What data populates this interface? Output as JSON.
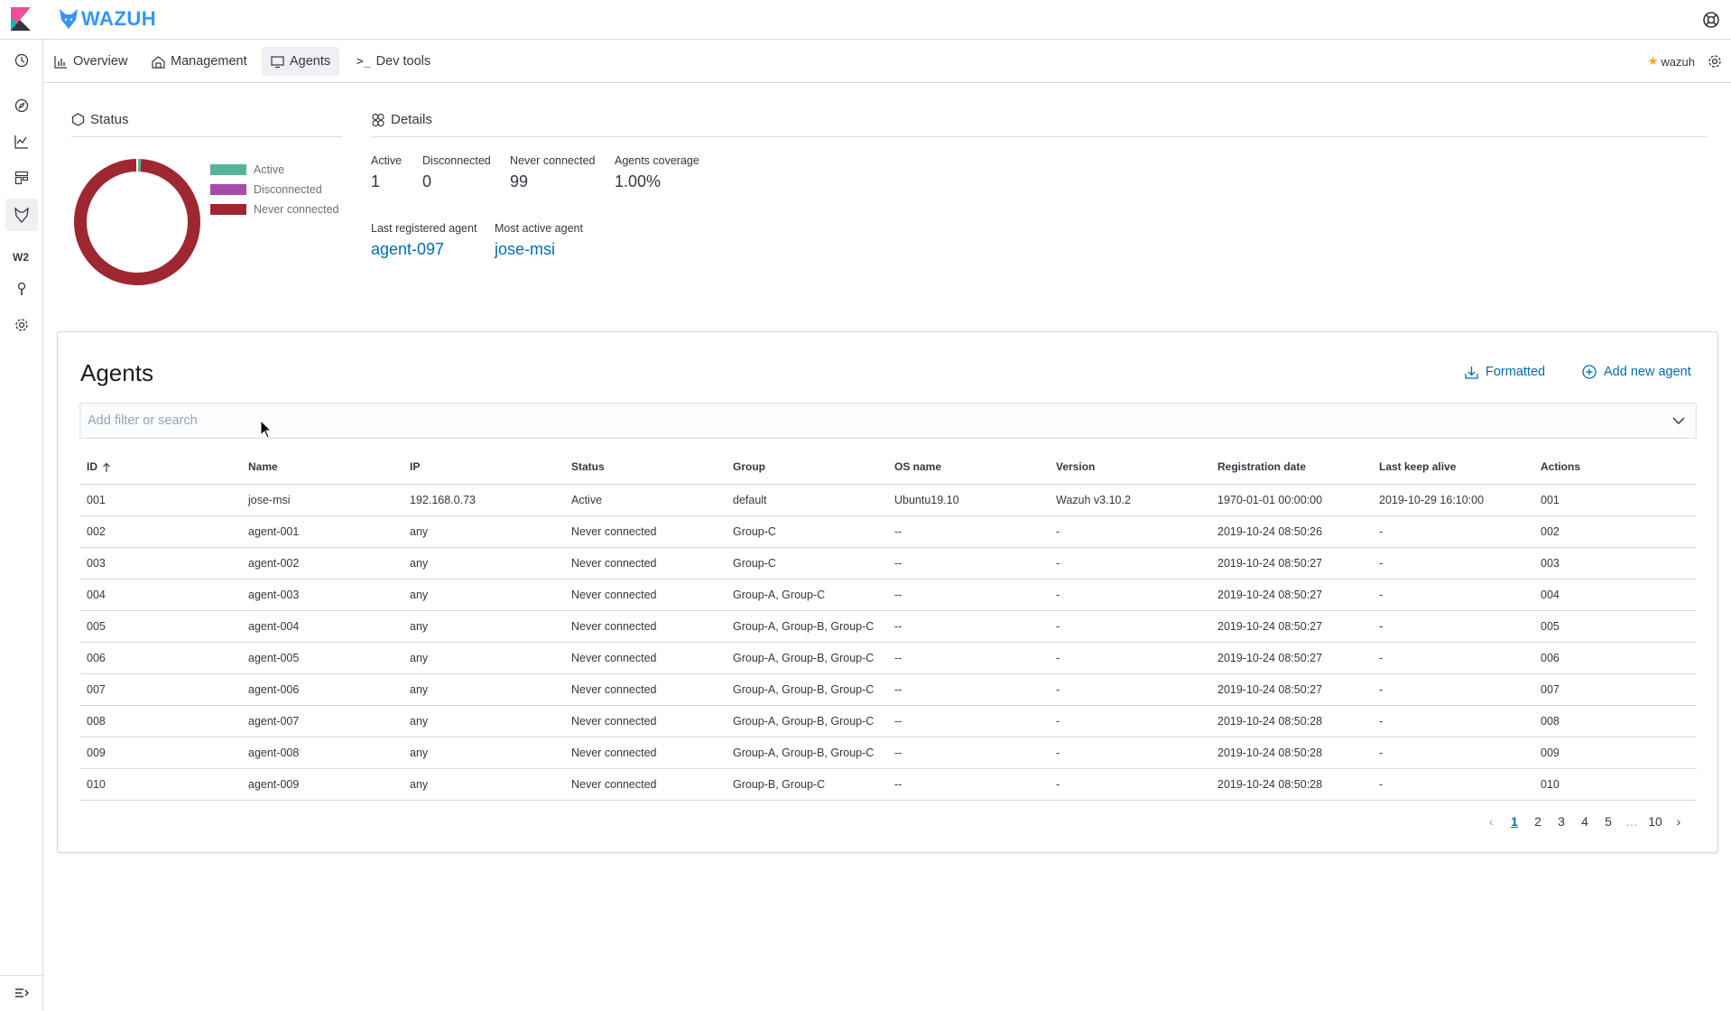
{
  "header": {
    "brand": "WAZUH"
  },
  "nav_tabs": [
    {
      "label": "Overview",
      "icon": "chart-icon"
    },
    {
      "label": "Management",
      "icon": "management-icon"
    },
    {
      "label": "Agents",
      "icon": "monitor-icon",
      "active": true
    },
    {
      "label": "Dev tools",
      "icon": "console-icon"
    }
  ],
  "sidebar": {
    "w2_label": "W2"
  },
  "user": {
    "name": "wazuh"
  },
  "status": {
    "title": "Status",
    "legend": [
      {
        "label": "Active",
        "color": "#54b399"
      },
      {
        "label": "Disconnected",
        "color": "#a64ca6"
      },
      {
        "label": "Never connected",
        "color": "#9e2731"
      }
    ],
    "ring_color": "#9e2731"
  },
  "chart_data": {
    "type": "pie",
    "categories": [
      "Active",
      "Disconnected",
      "Never connected"
    ],
    "values": [
      1,
      0,
      99
    ]
  },
  "details": {
    "title": "Details",
    "active_label": "Active",
    "active_value": "1",
    "disconnected_label": "Disconnected",
    "disconnected_value": "0",
    "never_label": "Never connected",
    "never_value": "99",
    "coverage_label": "Agents coverage",
    "coverage_value": "1.00%",
    "last_registered_label": "Last registered agent",
    "last_registered_value": "agent-097",
    "most_active_label": "Most active agent",
    "most_active_value": "jose-msi"
  },
  "agents": {
    "title": "Agents",
    "formatted_label": "Formatted",
    "add_label": "Add new agent",
    "search_placeholder": "Add filter or search",
    "columns": [
      "ID",
      "Name",
      "IP",
      "Status",
      "Group",
      "OS name",
      "Version",
      "Registration date",
      "Last keep alive",
      "Actions"
    ],
    "rows": [
      [
        "001",
        "jose-msi",
        "192.168.0.73",
        "Active",
        "default",
        "Ubuntu19.10",
        "Wazuh v3.10.2",
        "1970-01-01 00:00:00",
        "2019-10-29 16:10:00",
        "001"
      ],
      [
        "002",
        "agent-001",
        "any",
        "Never connected",
        "Group-C",
        "--",
        "-",
        "2019-10-24 08:50:26",
        "-",
        "002"
      ],
      [
        "003",
        "agent-002",
        "any",
        "Never connected",
        "Group-C",
        "--",
        "-",
        "2019-10-24 08:50:27",
        "-",
        "003"
      ],
      [
        "004",
        "agent-003",
        "any",
        "Never connected",
        "Group-A, Group-C",
        "--",
        "-",
        "2019-10-24 08:50:27",
        "-",
        "004"
      ],
      [
        "005",
        "agent-004",
        "any",
        "Never connected",
        "Group-A, Group-B, Group-C",
        "--",
        "-",
        "2019-10-24 08:50:27",
        "-",
        "005"
      ],
      [
        "006",
        "agent-005",
        "any",
        "Never connected",
        "Group-A, Group-B, Group-C",
        "--",
        "-",
        "2019-10-24 08:50:27",
        "-",
        "006"
      ],
      [
        "007",
        "agent-006",
        "any",
        "Never connected",
        "Group-A, Group-B, Group-C",
        "--",
        "-",
        "2019-10-24 08:50:27",
        "-",
        "007"
      ],
      [
        "008",
        "agent-007",
        "any",
        "Never connected",
        "Group-A, Group-B, Group-C",
        "--",
        "-",
        "2019-10-24 08:50:28",
        "-",
        "008"
      ],
      [
        "009",
        "agent-008",
        "any",
        "Never connected",
        "Group-A, Group-B, Group-C",
        "--",
        "-",
        "2019-10-24 08:50:28",
        "-",
        "009"
      ],
      [
        "010",
        "agent-009",
        "any",
        "Never connected",
        "Group-B, Group-C",
        "--",
        "-",
        "2019-10-24 08:50:28",
        "-",
        "010"
      ]
    ]
  },
  "pagination": {
    "pages": [
      "1",
      "2",
      "3",
      "4",
      "5"
    ],
    "ellipsis": "…",
    "last": "10",
    "current": "1"
  },
  "colors": {
    "accent": "#006bb4",
    "brand": "#3595f9",
    "border": "#d3dae6"
  }
}
